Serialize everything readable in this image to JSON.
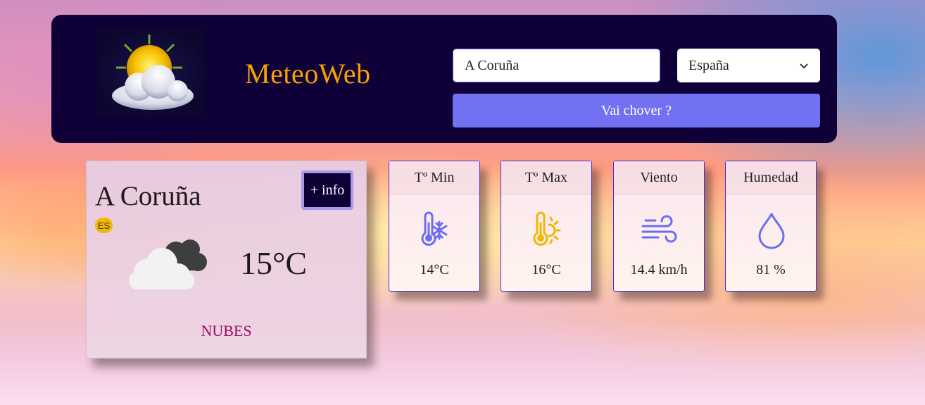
{
  "header": {
    "brand": "MeteoWeb",
    "city_input": {
      "value": "A Coruña",
      "placeholder": ""
    },
    "country_select": {
      "selected": "España"
    },
    "search_button": "Vai chover ?"
  },
  "main_card": {
    "city": "A Coruña",
    "country_code": "ES",
    "info_button": "+ info",
    "temperature": "15°C",
    "description": "NUBES",
    "icon": "cloudy-icon"
  },
  "stats": [
    {
      "label": "Tº Min",
      "value": "14°C",
      "icon": "thermometer-cold-icon",
      "color": "#6b6ef0"
    },
    {
      "label": "Tº Max",
      "value": "16°C",
      "icon": "thermometer-sun-icon",
      "color": "#f2b705"
    },
    {
      "label": "Viento",
      "value": "14.4 km/h",
      "icon": "wind-icon",
      "color": "#6b6ef0"
    },
    {
      "label": "Humedad",
      "value": "81 %",
      "icon": "droplet-icon",
      "color": "#6b6ef0"
    }
  ],
  "colors": {
    "header_bg": "#100038",
    "brand": "#f5a100",
    "button": "#7271f1",
    "description": "#9a0b63",
    "badge": "#f2b705"
  }
}
